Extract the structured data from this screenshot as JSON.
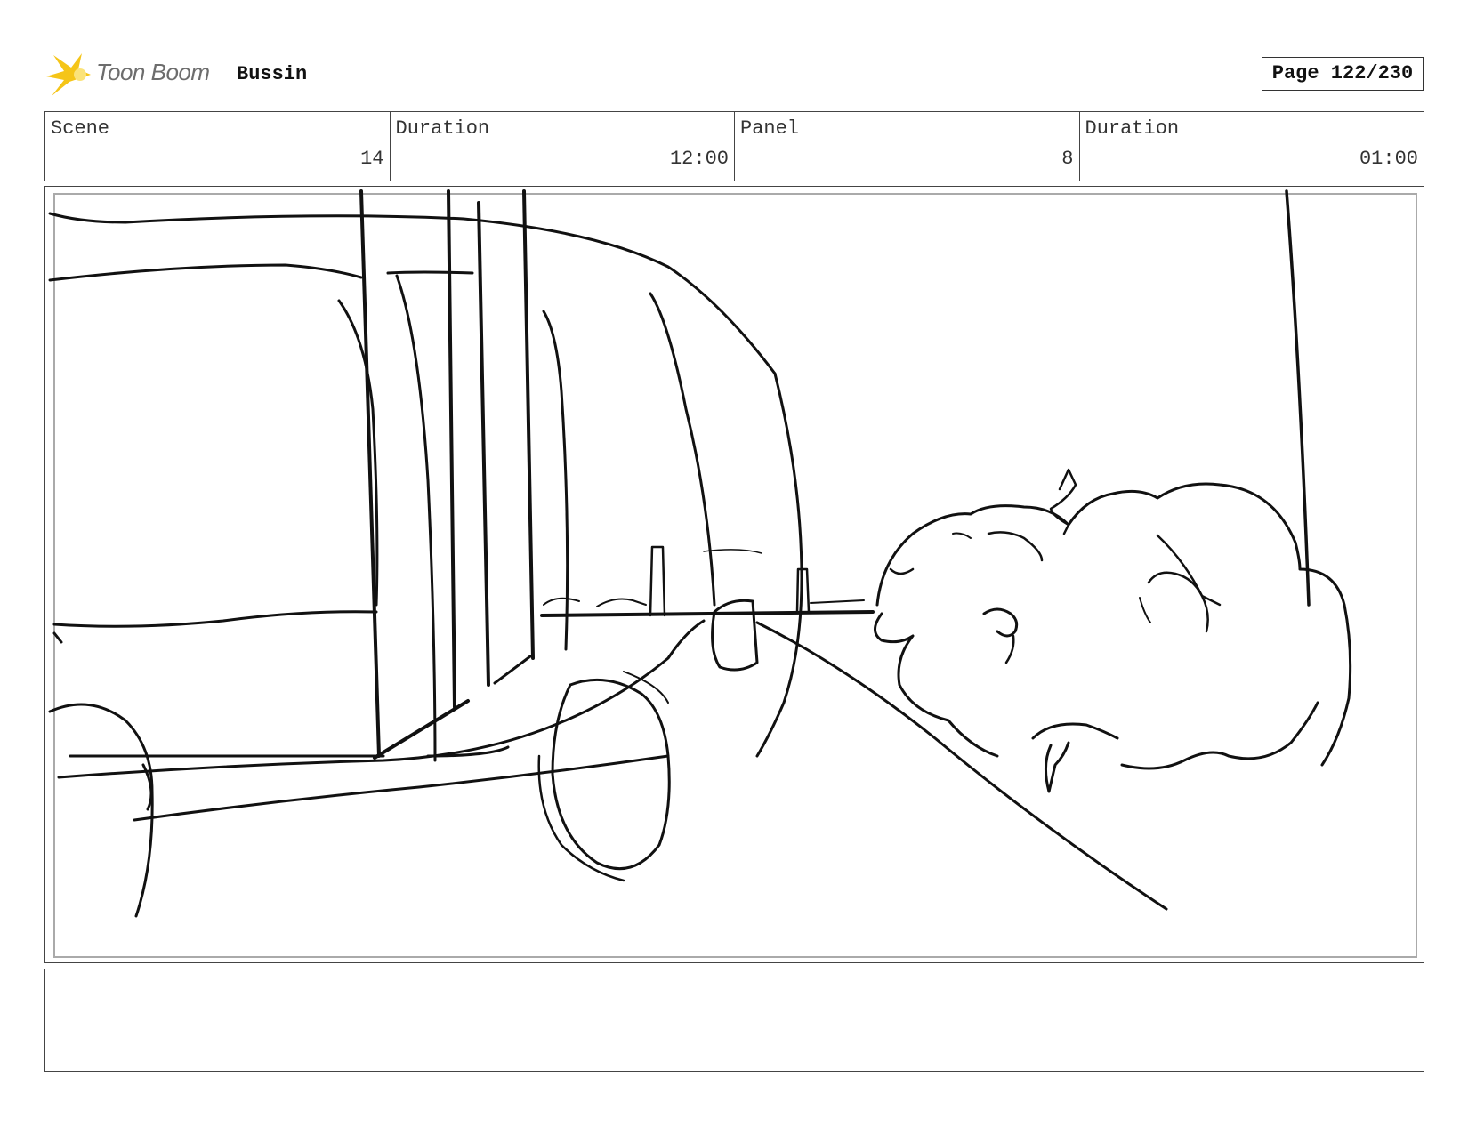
{
  "header": {
    "logo_text": "Toon Boom",
    "project_title": "Bussin",
    "page_indicator": "Page 122/230"
  },
  "info": {
    "scene_label": "Scene",
    "scene_value": "14",
    "scene_duration_label": "Duration",
    "scene_duration_value": "12:00",
    "panel_label": "Panel",
    "panel_value": "8",
    "panel_duration_label": "Duration",
    "panel_duration_value": "01:00"
  },
  "caption": {
    "text": ""
  },
  "colors": {
    "logo_star": "#f5c518",
    "logo_text": "#6d6d6d",
    "border": "#444444",
    "sketch_line": "#111111"
  }
}
